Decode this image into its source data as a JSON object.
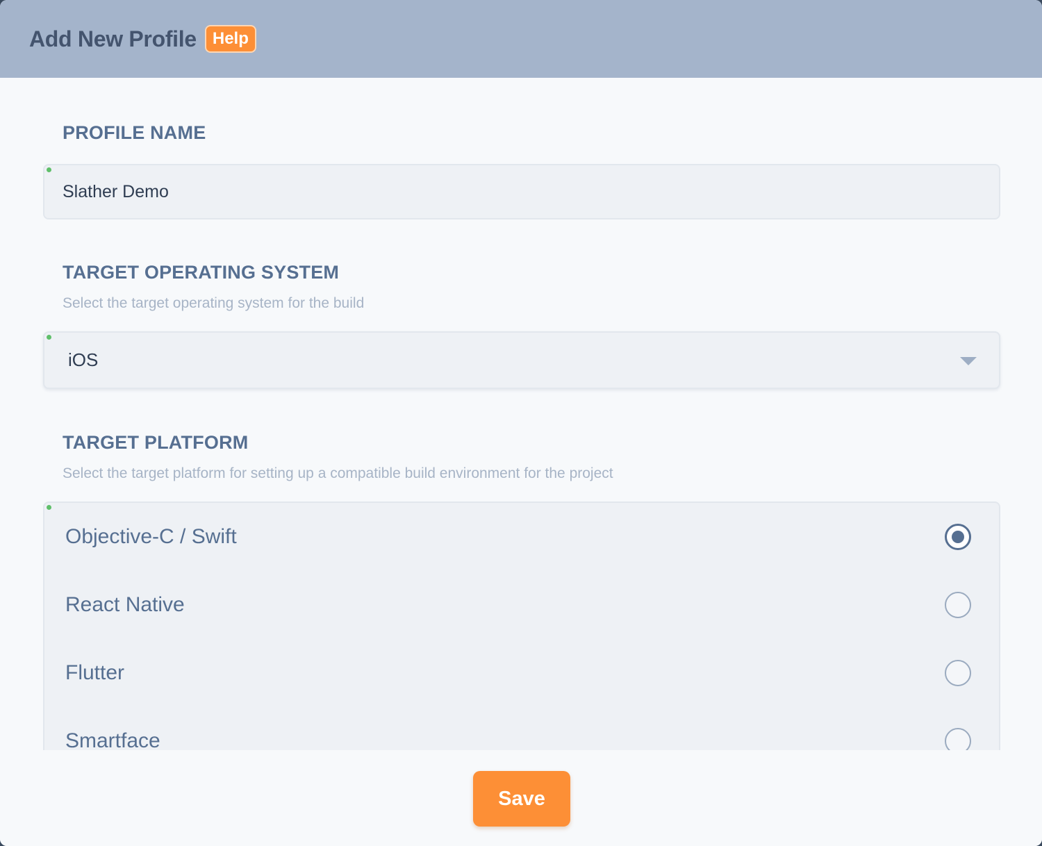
{
  "header": {
    "title": "Add New Profile",
    "help_label": "Help"
  },
  "profile_name": {
    "label": "PROFILE NAME",
    "value": "Slather Demo"
  },
  "target_os": {
    "label": "TARGET OPERATING SYSTEM",
    "description": "Select the target operating system for the build",
    "selected": "iOS"
  },
  "target_platform": {
    "label": "TARGET PLATFORM",
    "description": "Select the target platform for setting up a compatible build environment for the project",
    "options": [
      {
        "label": "Objective-C / Swift",
        "checked": true
      },
      {
        "label": "React Native",
        "checked": false
      },
      {
        "label": "Flutter",
        "checked": false
      },
      {
        "label": "Smartface",
        "checked": false
      }
    ]
  },
  "footer": {
    "save_label": "Save"
  },
  "colors": {
    "accent": "#fd8f36",
    "header_bg": "#a4b4cb",
    "label": "#566f91",
    "status_dot": "#5fbf6a"
  }
}
